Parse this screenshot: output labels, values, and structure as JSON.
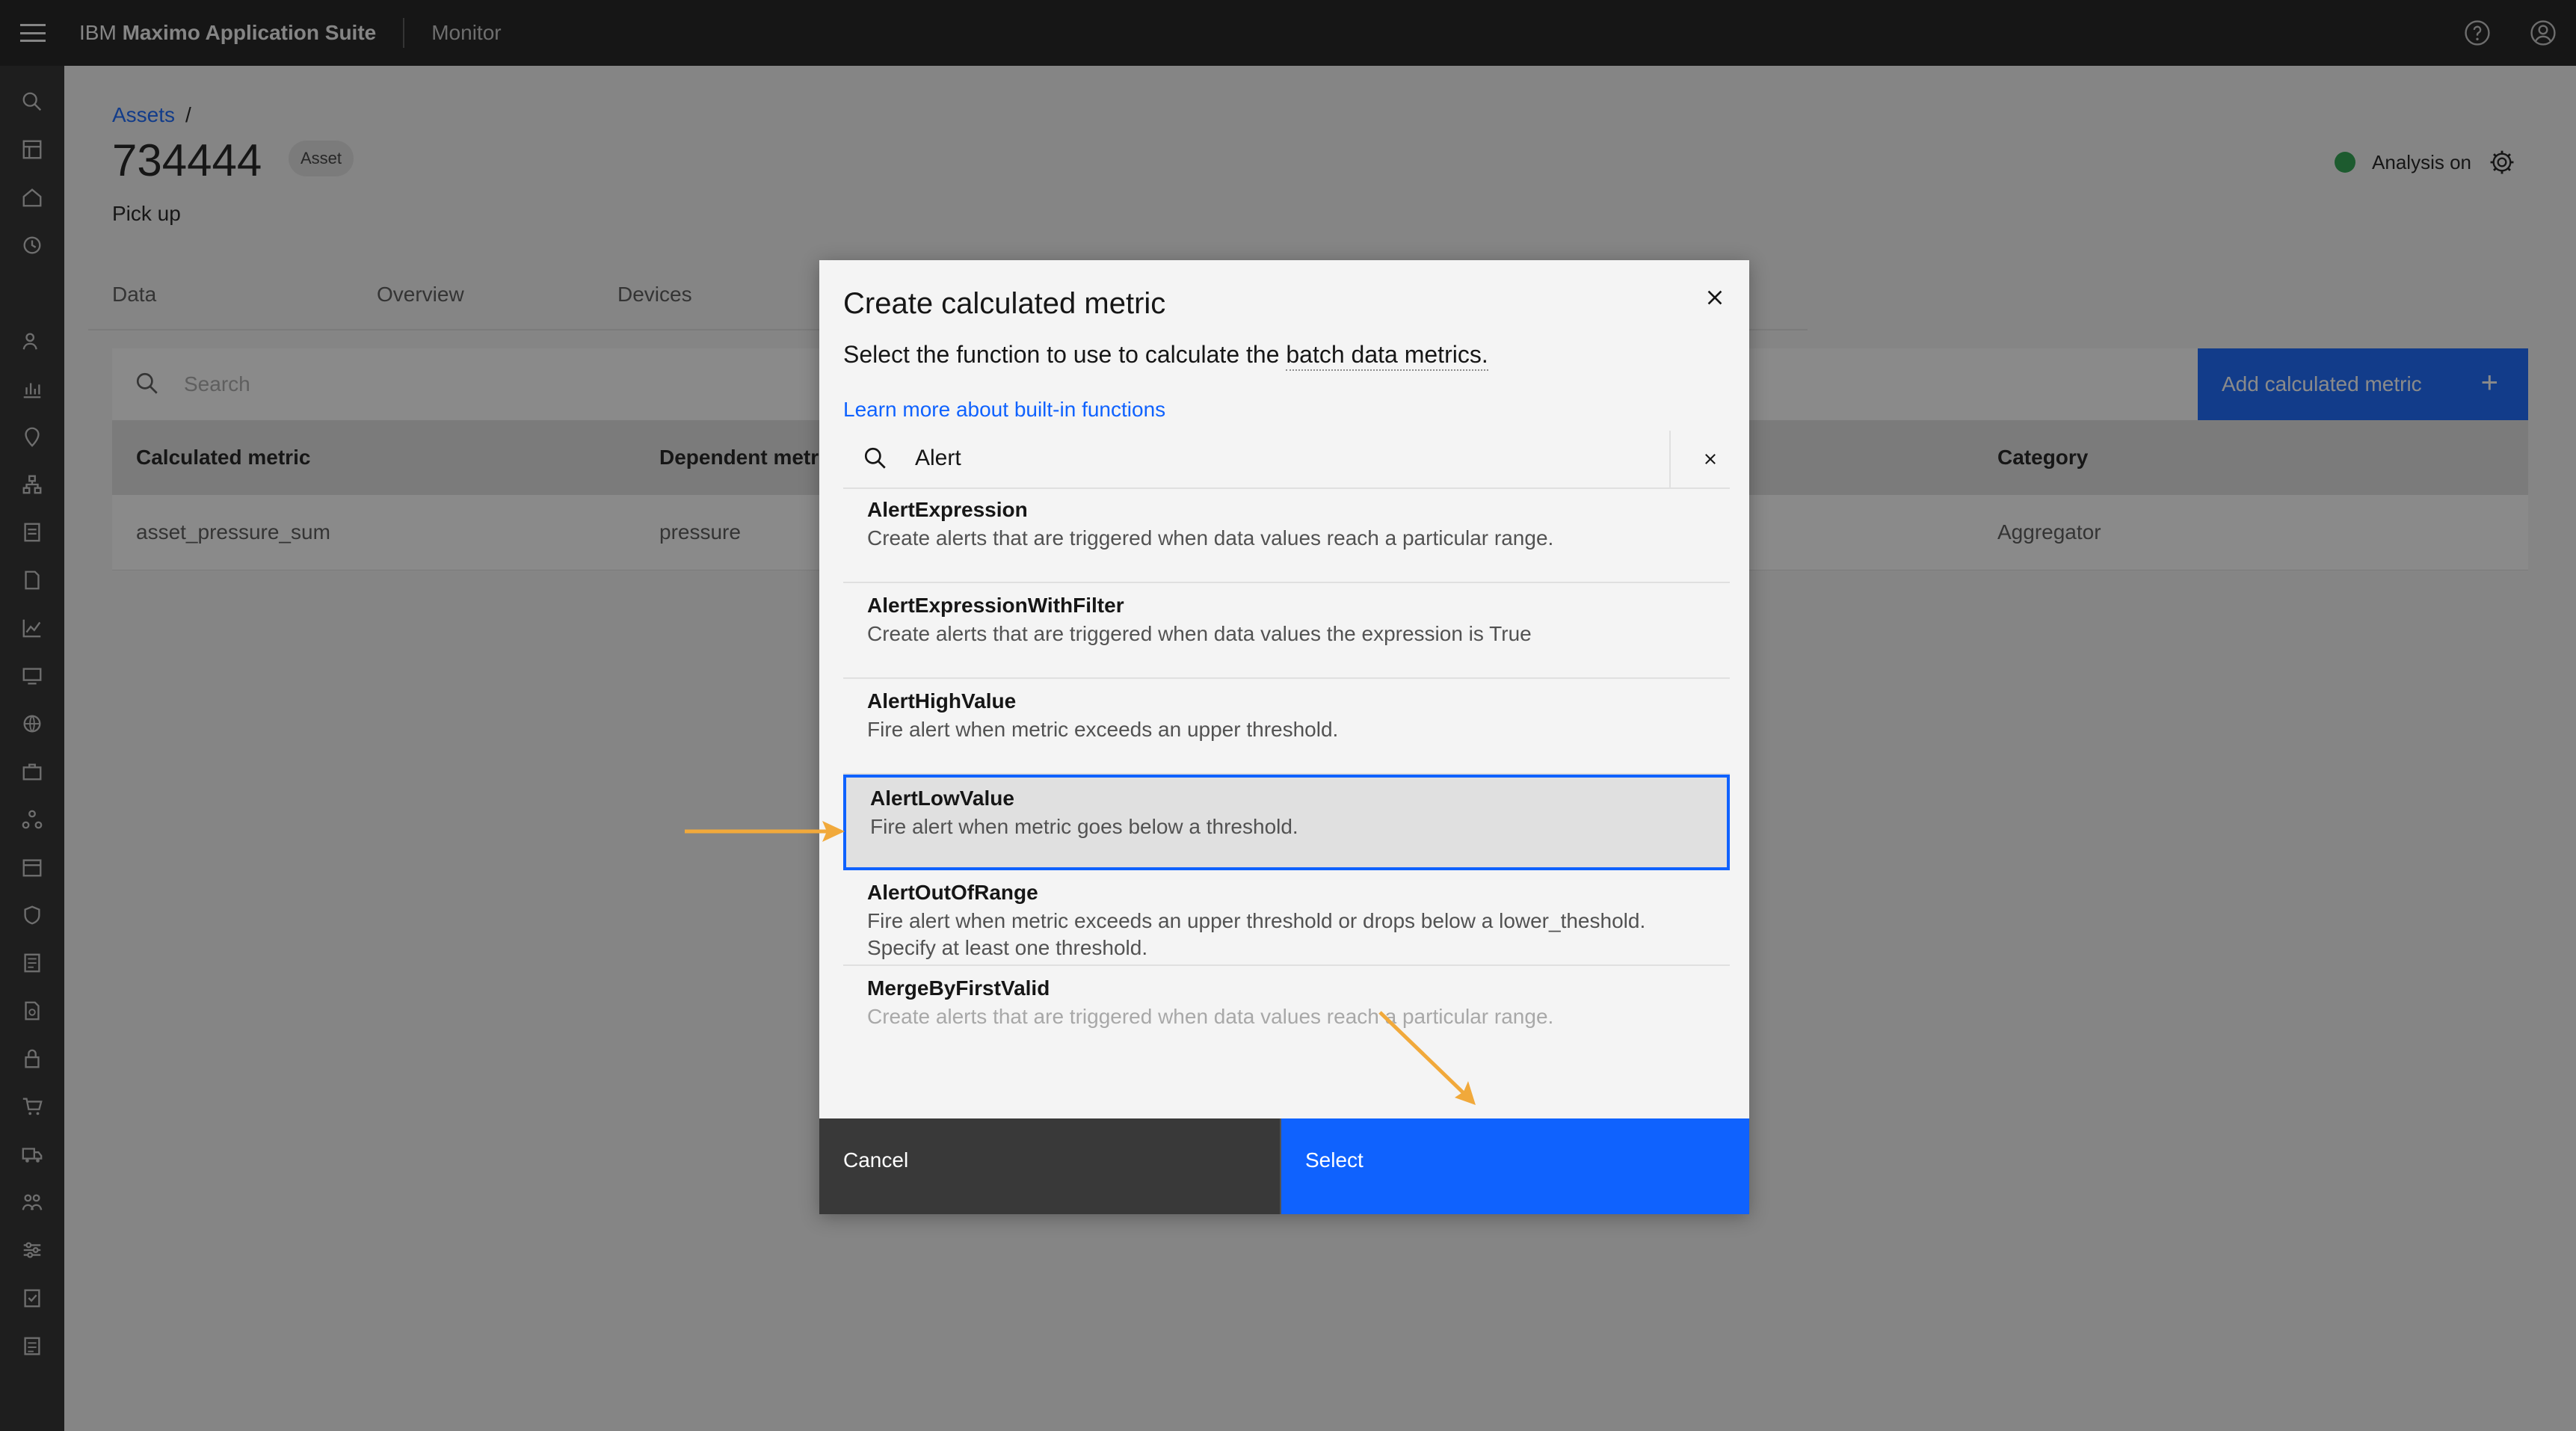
{
  "header": {
    "brand_prefix": "IBM",
    "brand_name": "Maximo Application Suite",
    "product": "Monitor"
  },
  "page": {
    "breadcrumb_root": "Assets",
    "breadcrumb_sep": "/",
    "asset_id": "734444",
    "asset_tag": "Asset",
    "asset_description": "Pick up",
    "analysis_label": "Analysis on",
    "tabs": [
      "Data",
      "Overview",
      "Devices"
    ],
    "search_placeholder": "Search",
    "add_button_label": "Add calculated metric",
    "add_button_icon": "+",
    "table": {
      "headers": [
        "Calculated metric",
        "Dependent metrics",
        "Category"
      ],
      "rows": [
        [
          "asset_pressure_sum",
          "pressure",
          "Aggregator"
        ]
      ]
    }
  },
  "modal": {
    "title": "Create calculated metric",
    "description_prefix": "Select the function to use to calculate the",
    "description_term": "batch data metrics.",
    "learn_more_link": "Learn more about built-in functions",
    "search_value": "Alert",
    "functions": [
      {
        "name": "AlertExpression",
        "description": "Create alerts that are triggered when data values reach a particular range."
      },
      {
        "name": "AlertExpressionWithFilter",
        "description": "Create alerts that are triggered when data values the expression is True"
      },
      {
        "name": "AlertHighValue",
        "description": "Fire alert when metric exceeds an upper threshold."
      },
      {
        "name": "AlertLowValue",
        "description": "Fire alert when metric goes below a threshold."
      },
      {
        "name": "AlertOutOfRange",
        "description": "Fire alert when metric exceeds an upper threshold or drops below a lower_theshold. Specify at least one threshold."
      },
      {
        "name": "MergeByFirstValid",
        "description": "Create alerts that are triggered when data values reach a particular range."
      }
    ],
    "selected_function": "AlertLowValue",
    "cancel_label": "Cancel",
    "select_label": "Select"
  },
  "colors": {
    "accent": "#0f62fe",
    "annotation": "#f1a93b",
    "status_green": "#24a148"
  },
  "icons": {
    "menu": "hamburger-icon",
    "help": "help-icon",
    "user": "user-avatar-icon",
    "settings": "gear-icon",
    "search": "search-icon",
    "close": "close-icon",
    "clear": "clear-icon"
  }
}
